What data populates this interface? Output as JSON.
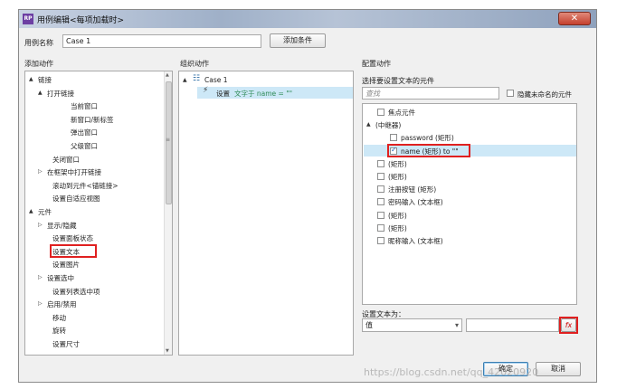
{
  "window": {
    "title": "用例编辑<每项加载时>",
    "app_icon": "RP",
    "close_glyph": "✕"
  },
  "case_name": {
    "label": "用例名称",
    "value": "Case 1",
    "add_condition_label": "添加条件"
  },
  "columns": {
    "add_action": "添加动作",
    "organize_action": "组织动作",
    "configure_action": "配置动作"
  },
  "add_action_tree": [
    {
      "text": "链接",
      "depth": 0,
      "toggle": "▲"
    },
    {
      "text": "打开链接",
      "depth": 1,
      "toggle": "▲"
    },
    {
      "text": "当前窗口",
      "depth": 3,
      "toggle": ""
    },
    {
      "text": "新窗口/新标签",
      "depth": 3,
      "toggle": ""
    },
    {
      "text": "弹出窗口",
      "depth": 3,
      "toggle": ""
    },
    {
      "text": "父级窗口",
      "depth": 3,
      "toggle": ""
    },
    {
      "text": "关闭窗口",
      "depth": 2,
      "toggle": ""
    },
    {
      "text": "在框架中打开链接",
      "depth": 1,
      "toggle": "▷"
    },
    {
      "text": "滚动到元件<锚链接>",
      "depth": 2,
      "toggle": ""
    },
    {
      "text": "设置自适应视图",
      "depth": 2,
      "toggle": ""
    },
    {
      "text": "元件",
      "depth": 0,
      "toggle": "▲"
    },
    {
      "text": "显示/隐藏",
      "depth": 1,
      "toggle": "▷"
    },
    {
      "text": "设置面板状态",
      "depth": 2,
      "toggle": ""
    },
    {
      "text": "设置文本",
      "depth": 2,
      "toggle": ""
    },
    {
      "text": "设置图片",
      "depth": 2,
      "toggle": ""
    },
    {
      "text": "设置选中",
      "depth": 1,
      "toggle": "▷"
    },
    {
      "text": "设置列表选中项",
      "depth": 2,
      "toggle": ""
    },
    {
      "text": "启用/禁用",
      "depth": 1,
      "toggle": "▷"
    },
    {
      "text": "移动",
      "depth": 2,
      "toggle": ""
    },
    {
      "text": "旋转",
      "depth": 2,
      "toggle": ""
    },
    {
      "text": "设置尺寸",
      "depth": 2,
      "toggle": ""
    }
  ],
  "organize": {
    "case_label": "Case 1",
    "case_toggle": "▲",
    "action_prefix": "设置",
    "action_detail": "文字于 name = \"\""
  },
  "configure": {
    "select_label": "选择要设置文本的元件",
    "search_placeholder": "查找",
    "hide_unnamed_label": "隐藏未命名的元件",
    "hide_unnamed_checked": false,
    "widgets": [
      {
        "text": "焦点元件",
        "depth": 1,
        "toggle": "",
        "checkbox": true,
        "checked": false,
        "selected": false
      },
      {
        "text": "(中继器)",
        "depth": 0,
        "toggle": "▲",
        "checkbox": false,
        "checked": false,
        "selected": false
      },
      {
        "text": "password (矩形)",
        "depth": 2,
        "toggle": "",
        "checkbox": true,
        "checked": false,
        "selected": false
      },
      {
        "text": "name (矩形) to \"\"",
        "depth": 2,
        "toggle": "",
        "checkbox": true,
        "checked": true,
        "selected": true
      },
      {
        "text": "(矩形)",
        "depth": 1,
        "toggle": "",
        "checkbox": true,
        "checked": false,
        "selected": false
      },
      {
        "text": "(矩形)",
        "depth": 1,
        "toggle": "",
        "checkbox": true,
        "checked": false,
        "selected": false
      },
      {
        "text": "注册按钮 (矩形)",
        "depth": 1,
        "toggle": "",
        "checkbox": true,
        "checked": false,
        "selected": false
      },
      {
        "text": "密码输入 (文本框)",
        "depth": 1,
        "toggle": "",
        "checkbox": true,
        "checked": false,
        "selected": false
      },
      {
        "text": "(矩形)",
        "depth": 1,
        "toggle": "",
        "checkbox": true,
        "checked": false,
        "selected": false
      },
      {
        "text": "(矩形)",
        "depth": 1,
        "toggle": "",
        "checkbox": true,
        "checked": false,
        "selected": false
      },
      {
        "text": "昵称输入 (文本框)",
        "depth": 1,
        "toggle": "",
        "checkbox": true,
        "checked": false,
        "selected": false
      }
    ],
    "set_text_label": "设置文本为：",
    "value_type": "值",
    "value_input": "",
    "fx_label": "fx"
  },
  "footer": {
    "ok_label": "确定",
    "cancel_label": "取消"
  },
  "watermark": "https://blog.csdn.net/qq_42020920",
  "colors": {
    "highlight_red": "#e02020",
    "selection_blue": "#cde8f7",
    "action_green": "#2e8b57"
  },
  "icons": {
    "lightning": "⚡",
    "case": "☷",
    "scroll_up": "▲",
    "scroll_down": "▼",
    "dropdown": "▾",
    "grip": "≡"
  }
}
